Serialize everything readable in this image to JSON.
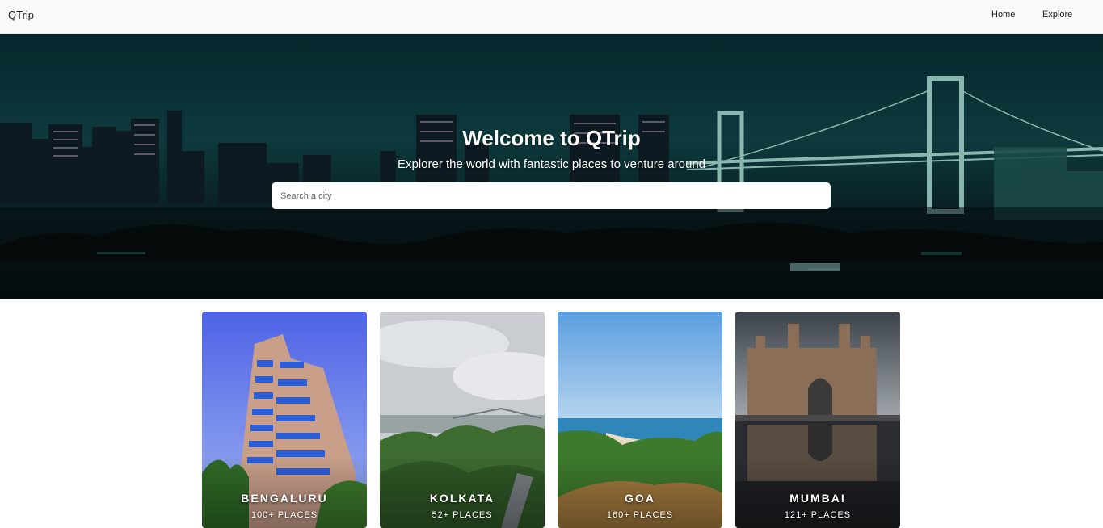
{
  "navbar": {
    "brand": "QTrip",
    "links": [
      {
        "label": "Home"
      },
      {
        "label": "Explore"
      }
    ]
  },
  "hero": {
    "title": "Welcome to QTrip",
    "subtitle": "Explorer the world with fantastic places to venture around",
    "search_placeholder": "Search a city"
  },
  "cities": [
    {
      "name": "BENGALURU",
      "places": "100+ PLACES"
    },
    {
      "name": "KOLKATA",
      "places": "52+ PLACES"
    },
    {
      "name": "GOA",
      "places": "160+ PLACES"
    },
    {
      "name": "MUMBAI",
      "places": "121+ PLACES"
    }
  ],
  "colors": {
    "navbar_bg": "#f8f9fa",
    "hero_tint": "#0d3a3d",
    "text_light": "#ffffff"
  }
}
